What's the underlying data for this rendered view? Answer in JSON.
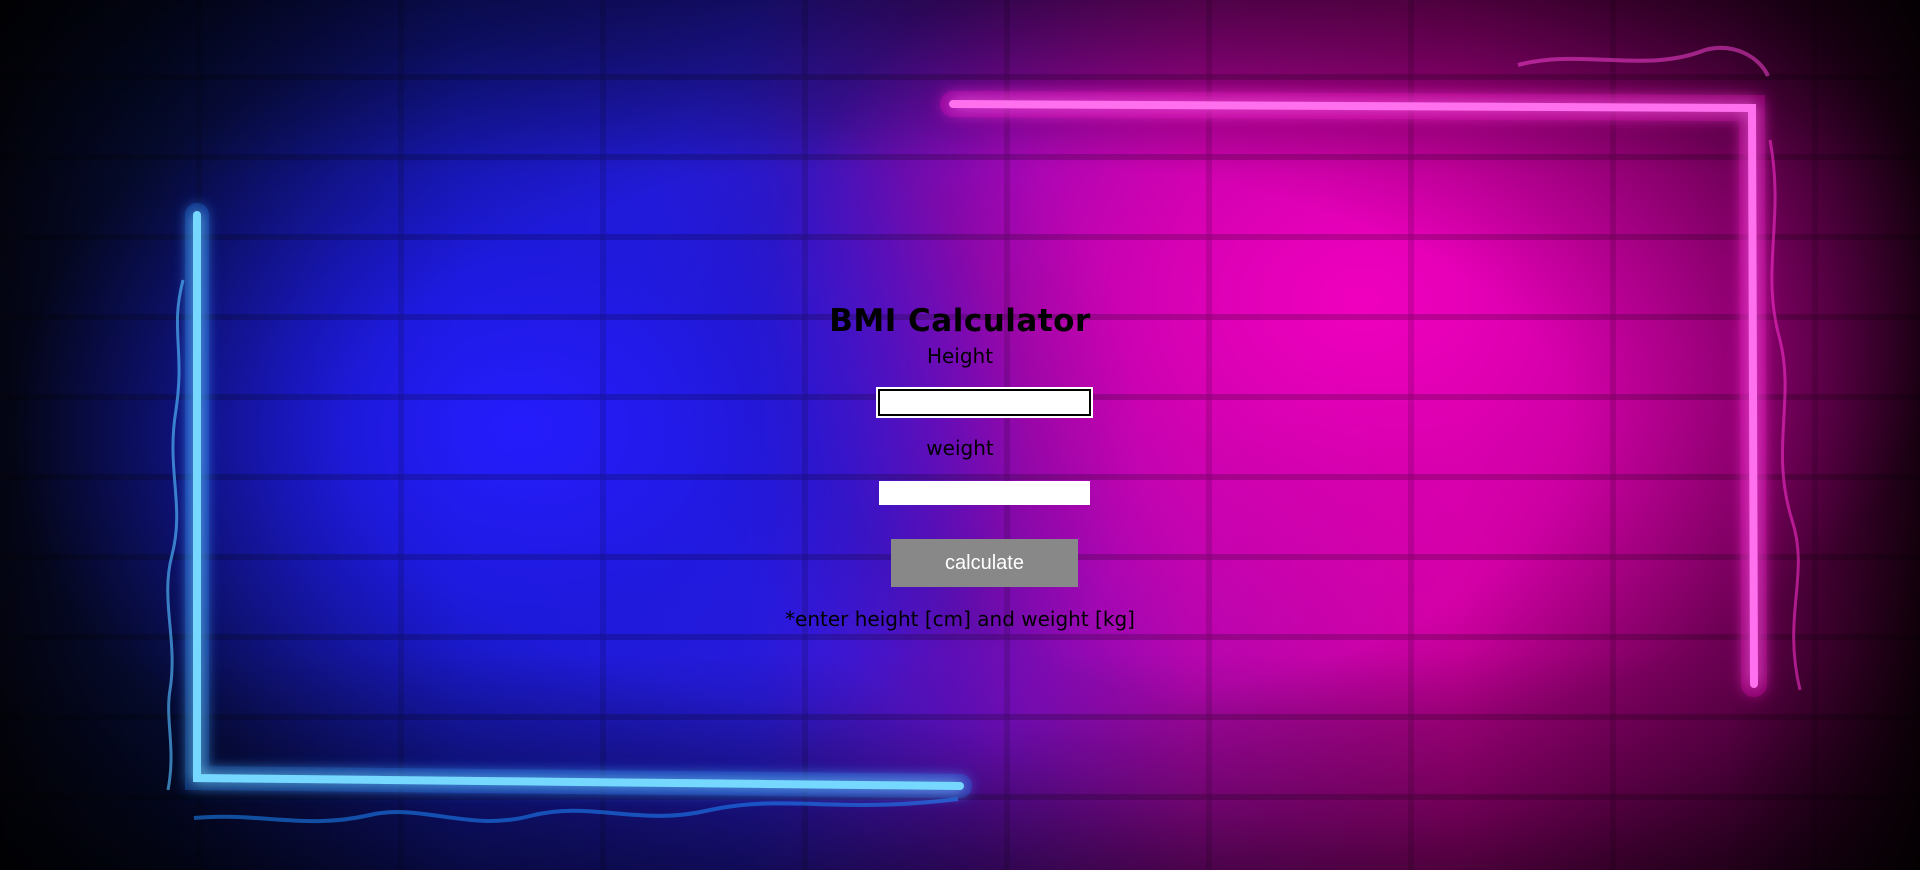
{
  "page": {
    "title": "BMI Calculator"
  },
  "form": {
    "height_label": "Height",
    "height_value": "",
    "height_placeholder": "",
    "weight_label": "weight",
    "weight_value": "",
    "weight_placeholder": "",
    "calculate_label": "calculate",
    "hint": "*enter height [cm] and weight [kg]"
  },
  "colors": {
    "neon_blue": "#3fb8ff",
    "neon_pink": "#ff22d6",
    "button_bg": "#888888",
    "text": "#000000",
    "input_bg": "#ffffff"
  },
  "icons": {
    "blue_frame": "neon-blue-corner-frame",
    "pink_frame": "neon-pink-corner-frame"
  }
}
